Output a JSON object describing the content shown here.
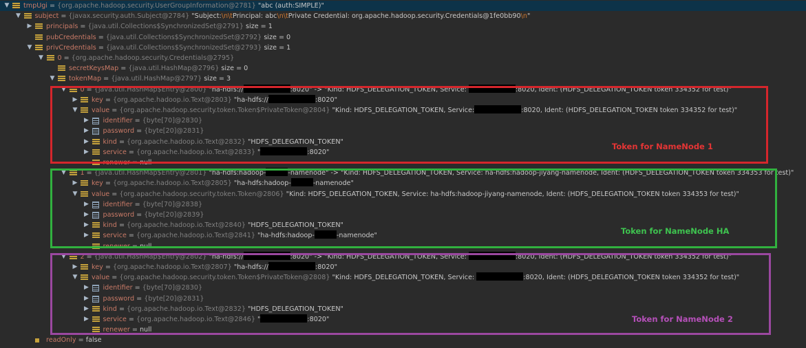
{
  "tree": [
    {
      "depth": 0,
      "toggle": "▼",
      "icon": "field",
      "sel": true,
      "name": "tmpUgi",
      "type": "{org.apache.hadoop.security.UserGroupInformation@2781}",
      "value": [
        {
          "t": "\"abc (auth:SIMPLE)\""
        }
      ]
    },
    {
      "depth": 1,
      "toggle": "▼",
      "icon": "field",
      "name": "subject",
      "type": "{javax.security.auth.Subject@2784}",
      "value": [
        {
          "t": "\"Subject:"
        },
        {
          "e": "\\n\\t"
        },
        {
          "t": "Principal: abc"
        },
        {
          "e": "\\n\\t"
        },
        {
          "t": "Private Credential: org.apache.hadoop.security.Credentials@1fe0bb90"
        },
        {
          "e": "\\n"
        },
        {
          "t": "\""
        }
      ]
    },
    {
      "depth": 2,
      "toggle": "▶",
      "icon": "field",
      "name": "principals",
      "type": "{java.util.Collections$SynchronizedSet@2791}",
      "value": [
        {
          "t": " size = 1"
        }
      ]
    },
    {
      "depth": 2,
      "toggle": "",
      "icon": "field",
      "name": "pubCredentials",
      "type": "{java.util.Collections$SynchronizedSet@2792}",
      "value": [
        {
          "t": " size = 0"
        }
      ]
    },
    {
      "depth": 2,
      "toggle": "▼",
      "icon": "field",
      "name": "privCredentials",
      "type": "{java.util.Collections$SynchronizedSet@2793}",
      "value": [
        {
          "t": " size = 1"
        }
      ]
    },
    {
      "depth": 3,
      "toggle": "▼",
      "icon": "field",
      "name": "0",
      "type": "{org.apache.hadoop.security.Credentials@2795}",
      "value": []
    },
    {
      "depth": 4,
      "toggle": "",
      "icon": "field",
      "name": "secretKeysMap",
      "type": "{java.util.HashMap@2796}",
      "value": [
        {
          "t": " size = 0"
        }
      ]
    },
    {
      "depth": 4,
      "toggle": "▼",
      "icon": "field",
      "name": "tokenMap",
      "type": "{java.util.HashMap@2797}",
      "value": [
        {
          "t": " size = 3"
        }
      ]
    },
    {
      "depth": 5,
      "toggle": "▼",
      "icon": "field",
      "name": "0",
      "type": "{java.util.HashMap$Entry@2800}",
      "value": [
        {
          "t": "\"ha-hdfs://"
        },
        {
          "r": 68
        },
        {
          "t": ":8020\" -> \"Kind: HDFS_DELEGATION_TOKEN, Service: "
        },
        {
          "r": 68
        },
        {
          "t": ":8020, Ident: (HDFS_DELEGATION_TOKEN token 334352 for test)\""
        }
      ]
    },
    {
      "depth": 6,
      "toggle": "▶",
      "icon": "field",
      "name": "key",
      "type": "{org.apache.hadoop.io.Text@2803}",
      "value": [
        {
          "t": "\"ha-hdfs://"
        },
        {
          "r": 68
        },
        {
          "t": ":8020\""
        }
      ]
    },
    {
      "depth": 6,
      "toggle": "▼",
      "icon": "field",
      "name": "value",
      "type": "{org.apache.hadoop.security.token.Token$PrivateToken@2804}",
      "value": [
        {
          "t": "\"Kind: HDFS_DELEGATION_TOKEN, Service:"
        },
        {
          "r": 68
        },
        {
          "t": ":8020, Ident: (HDFS_DELEGATION_TOKEN token 334352 for test)\""
        }
      ]
    },
    {
      "depth": 7,
      "toggle": "▶",
      "icon": "arr",
      "name": "identifier",
      "type": "{byte[70]@2830}",
      "value": []
    },
    {
      "depth": 7,
      "toggle": "▶",
      "icon": "arr",
      "name": "password",
      "type": "{byte[20]@2831}",
      "value": []
    },
    {
      "depth": 7,
      "toggle": "▶",
      "icon": "field",
      "name": "kind",
      "type": "{org.apache.hadoop.io.Text@2832}",
      "value": [
        {
          "t": "\"HDFS_DELEGATION_TOKEN\""
        }
      ]
    },
    {
      "depth": 7,
      "toggle": "▶",
      "icon": "field",
      "name": "service",
      "type": "{org.apache.hadoop.io.Text@2833}",
      "value": [
        {
          "t": "\""
        },
        {
          "r": 68
        },
        {
          "t": ":8020\""
        }
      ]
    },
    {
      "depth": 7,
      "toggle": "",
      "icon": "field",
      "name": "renewer",
      "type": "",
      "value": [
        {
          "t": "null"
        }
      ]
    },
    {
      "depth": 5,
      "toggle": "▼",
      "icon": "field",
      "name": "1",
      "type": "{java.util.HashMap$Entry@2801}",
      "value": [
        {
          "t": "\"ha-hdfs:hadoop-"
        },
        {
          "r": 32
        },
        {
          "t": "-namenode\" -> \"Kind: HDFS_DELEGATION_TOKEN, Service: ha-hdfs:hadoop-jiyang-namenode, Ident: (HDFS_DELEGATION_TOKEN token 334353 for test)\""
        }
      ]
    },
    {
      "depth": 6,
      "toggle": "▶",
      "icon": "field",
      "name": "key",
      "type": "{org.apache.hadoop.io.Text@2805}",
      "value": [
        {
          "t": "\"ha-hdfs:hadoop-"
        },
        {
          "r": 32
        },
        {
          "t": "-namenode\""
        }
      ]
    },
    {
      "depth": 6,
      "toggle": "▼",
      "icon": "field",
      "name": "value",
      "type": "{org.apache.hadoop.security.token.Token@2806}",
      "value": [
        {
          "t": "\"Kind: HDFS_DELEGATION_TOKEN, Service: ha-hdfs:hadoop-jiyang-namenode, Ident: (HDFS_DELEGATION_TOKEN token 334353 for test)\""
        }
      ]
    },
    {
      "depth": 7,
      "toggle": "▶",
      "icon": "arr",
      "name": "identifier",
      "type": "{byte[70]@2838}",
      "value": []
    },
    {
      "depth": 7,
      "toggle": "▶",
      "icon": "arr",
      "name": "password",
      "type": "{byte[20]@2839}",
      "value": []
    },
    {
      "depth": 7,
      "toggle": "▶",
      "icon": "field",
      "name": "kind",
      "type": "{org.apache.hadoop.io.Text@2840}",
      "value": [
        {
          "t": "\"HDFS_DELEGATION_TOKEN\""
        }
      ]
    },
    {
      "depth": 7,
      "toggle": "▶",
      "icon": "field",
      "name": "service",
      "type": "{org.apache.hadoop.io.Text@2841}",
      "value": [
        {
          "t": "\"ha-hdfs:hadoop-"
        },
        {
          "r": 32
        },
        {
          "t": "-namenode\""
        }
      ]
    },
    {
      "depth": 7,
      "toggle": "",
      "icon": "field",
      "name": "renewer",
      "type": "",
      "value": [
        {
          "t": "null"
        }
      ]
    },
    {
      "depth": 5,
      "toggle": "▼",
      "icon": "field",
      "name": "2",
      "type": "{java.util.HashMap$Entry@2802}",
      "value": [
        {
          "t": "\"ha-hdfs://"
        },
        {
          "r": 68
        },
        {
          "t": ":8020\" -> \"Kind: HDFS_DELEGATION_TOKEN, Service: "
        },
        {
          "r": 68
        },
        {
          "t": ":8020, Ident: (HDFS_DELEGATION_TOKEN token 334352 for test)\""
        }
      ]
    },
    {
      "depth": 6,
      "toggle": "▶",
      "icon": "field",
      "name": "key",
      "type": "{org.apache.hadoop.io.Text@2807}",
      "value": [
        {
          "t": "\"ha-hdfs://"
        },
        {
          "r": 68
        },
        {
          "t": ":8020\""
        }
      ]
    },
    {
      "depth": 6,
      "toggle": "▼",
      "icon": "field",
      "name": "value",
      "type": "{org.apache.hadoop.security.token.Token$PrivateToken@2808}",
      "value": [
        {
          "t": "\"Kind: HDFS_DELEGATION_TOKEN, Service: "
        },
        {
          "r": 68
        },
        {
          "t": ":8020, Ident: (HDFS_DELEGATION_TOKEN token 334352 for test)\""
        }
      ]
    },
    {
      "depth": 7,
      "toggle": "▶",
      "icon": "arr",
      "name": "identifier",
      "type": "{byte[70]@2830}",
      "value": []
    },
    {
      "depth": 7,
      "toggle": "▶",
      "icon": "arr",
      "name": "password",
      "type": "{byte[20]@2831}",
      "value": []
    },
    {
      "depth": 7,
      "toggle": "▶",
      "icon": "field",
      "name": "kind",
      "type": "{org.apache.hadoop.io.Text@2832}",
      "value": [
        {
          "t": "\"HDFS_DELEGATION_TOKEN\""
        }
      ]
    },
    {
      "depth": 7,
      "toggle": "▶",
      "icon": "field",
      "name": "service",
      "type": "{org.apache.hadoop.io.Text@2846}",
      "value": [
        {
          "t": "\""
        },
        {
          "r": 68
        },
        {
          "t": ":8020\""
        }
      ]
    },
    {
      "depth": 7,
      "toggle": "",
      "icon": "field",
      "name": "renewer",
      "type": "",
      "value": [
        {
          "t": "null"
        }
      ]
    },
    {
      "depth": 2,
      "toggle": "",
      "icon": "bool",
      "name": "readOnly",
      "type": "",
      "value": [
        {
          "t": "false"
        }
      ]
    }
  ],
  "annotations": {
    "red": "Token for NameNode 1",
    "green": "Token for NameNode HA",
    "purple": "Token for NameNode 2"
  },
  "colors": {
    "red": "#d5262c",
    "green": "#31b13f",
    "purple": "#9b48a0",
    "background": "#2b2b2b",
    "selection": "#0d3349"
  }
}
